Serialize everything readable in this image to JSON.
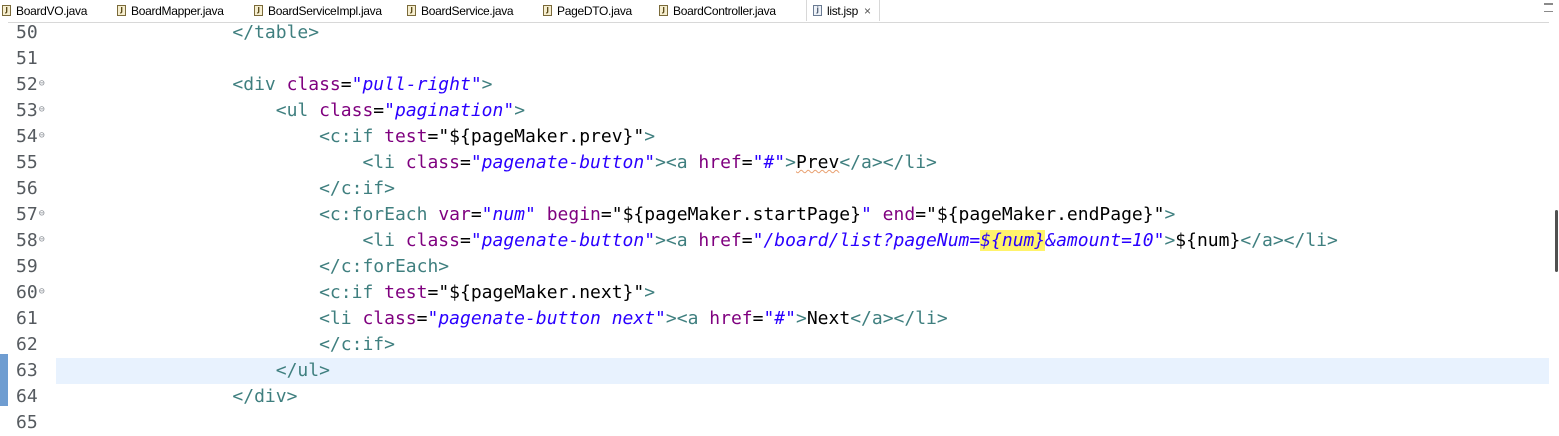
{
  "tabs": [
    {
      "label": "BoardVO.java",
      "icon": "java-file-icon",
      "active": false
    },
    {
      "label": "BoardMapper.java",
      "icon": "java-file-icon",
      "active": false
    },
    {
      "label": "BoardServiceImpl.java",
      "icon": "java-file-icon",
      "active": false
    },
    {
      "label": "BoardService.java",
      "icon": "java-file-icon",
      "active": false
    },
    {
      "label": "PageDTO.java",
      "icon": "java-file-icon",
      "active": false
    },
    {
      "label": "BoardController.java",
      "icon": "java-file-icon",
      "active": false
    },
    {
      "label": "list.jsp",
      "icon": "jsp-file-icon",
      "active": true
    }
  ],
  "tab_close_glyph": "×",
  "colors": {
    "tag": "#3f7f7f",
    "attribute": "#7f007f",
    "string_value": "#2a00ff",
    "current_line": "#e8f2fe",
    "occurrence_highlight": "#fff36b",
    "change_marker": "#6f9dd1"
  },
  "lines": [
    {
      "num": "50",
      "fold": false,
      "indent": "                ",
      "tokens": [
        {
          "t": "tg",
          "v": "</table>"
        }
      ]
    },
    {
      "num": "51",
      "fold": false,
      "indent": "",
      "tokens": []
    },
    {
      "num": "52",
      "fold": true,
      "indent": "                ",
      "tokens": [
        {
          "t": "tg",
          "v": "<div "
        },
        {
          "t": "at",
          "v": "class"
        },
        {
          "t": "tx",
          "v": "="
        },
        {
          "t": "vl",
          "v": "\"pull-right\""
        },
        {
          "t": "tg",
          "v": ">"
        }
      ]
    },
    {
      "num": "53",
      "fold": true,
      "indent": "                    ",
      "tokens": [
        {
          "t": "tg",
          "v": "<ul "
        },
        {
          "t": "at",
          "v": "class"
        },
        {
          "t": "tx",
          "v": "="
        },
        {
          "t": "vl",
          "v": "\"pagination\""
        },
        {
          "t": "tg",
          "v": ">"
        }
      ]
    },
    {
      "num": "54",
      "fold": true,
      "indent": "                        ",
      "tokens": [
        {
          "t": "tg",
          "v": "<c:if "
        },
        {
          "t": "at",
          "v": "test"
        },
        {
          "t": "tx",
          "v": "=\"${pageMaker.prev}\""
        },
        {
          "t": "tg",
          "v": ">"
        }
      ]
    },
    {
      "num": "55",
      "fold": false,
      "indent": "                            ",
      "tokens": [
        {
          "t": "tg",
          "v": "<li "
        },
        {
          "t": "at",
          "v": "class"
        },
        {
          "t": "tx",
          "v": "="
        },
        {
          "t": "vl",
          "v": "\"pagenate-button\""
        },
        {
          "t": "tg",
          "v": "><a "
        },
        {
          "t": "at",
          "v": "href"
        },
        {
          "t": "tx",
          "v": "="
        },
        {
          "t": "vl",
          "v": "\"#\""
        },
        {
          "t": "tg",
          "v": ">"
        },
        {
          "t": "sq",
          "v": "Prev"
        },
        {
          "t": "tg",
          "v": "</a></li>"
        }
      ]
    },
    {
      "num": "56",
      "fold": false,
      "indent": "                        ",
      "tokens": [
        {
          "t": "tg",
          "v": "</c:if>"
        }
      ]
    },
    {
      "num": "57",
      "fold": true,
      "indent": "                        ",
      "tokens": [
        {
          "t": "tg",
          "v": "<c:forEach "
        },
        {
          "t": "at",
          "v": "var"
        },
        {
          "t": "tx",
          "v": "="
        },
        {
          "t": "vl",
          "v": "\"num\""
        },
        {
          "t": "tx",
          "v": " "
        },
        {
          "t": "at",
          "v": "begin"
        },
        {
          "t": "tx",
          "v": "=\"${pageMaker.startPage}"
        },
        {
          "t": "vl",
          "v": "\""
        },
        {
          "t": "tx",
          "v": " "
        },
        {
          "t": "at",
          "v": "end"
        },
        {
          "t": "tx",
          "v": "=\"${pageMaker.endPage}\""
        },
        {
          "t": "tg",
          "v": ">"
        }
      ]
    },
    {
      "num": "58",
      "fold": true,
      "indent": "                            ",
      "tokens": [
        {
          "t": "tg",
          "v": "<li "
        },
        {
          "t": "at",
          "v": "class"
        },
        {
          "t": "tx",
          "v": "="
        },
        {
          "t": "vl",
          "v": "\"pagenate-button\""
        },
        {
          "t": "tg",
          "v": "><a "
        },
        {
          "t": "at",
          "v": "href"
        },
        {
          "t": "tx",
          "v": "="
        },
        {
          "t": "vl",
          "v": "\"/board/list?pageNum="
        },
        {
          "t": "hl",
          "v": "${num}"
        },
        {
          "t": "vl",
          "v": "&amount=10\""
        },
        {
          "t": "tg",
          "v": ">"
        },
        {
          "t": "tx",
          "v": "${num}"
        },
        {
          "t": "tg",
          "v": "</a></li>"
        }
      ]
    },
    {
      "num": "59",
      "fold": false,
      "indent": "                        ",
      "tokens": [
        {
          "t": "tg",
          "v": "</c:forEach>"
        }
      ]
    },
    {
      "num": "60",
      "fold": true,
      "indent": "                        ",
      "tokens": [
        {
          "t": "tg",
          "v": "<c:if "
        },
        {
          "t": "at",
          "v": "test"
        },
        {
          "t": "tx",
          "v": "=\"${pageMaker.next}\""
        },
        {
          "t": "tg",
          "v": ">"
        }
      ]
    },
    {
      "num": "61",
      "fold": false,
      "indent": "                        ",
      "tokens": [
        {
          "t": "tg",
          "v": "<li "
        },
        {
          "t": "at",
          "v": "class"
        },
        {
          "t": "tx",
          "v": "="
        },
        {
          "t": "vl",
          "v": "\"pagenate-button next\""
        },
        {
          "t": "tg",
          "v": "><a "
        },
        {
          "t": "at",
          "v": "href"
        },
        {
          "t": "tx",
          "v": "="
        },
        {
          "t": "vl",
          "v": "\"#\""
        },
        {
          "t": "tg",
          "v": ">"
        },
        {
          "t": "tx",
          "v": "Next"
        },
        {
          "t": "tg",
          "v": "</a></li>"
        }
      ]
    },
    {
      "num": "62",
      "fold": false,
      "indent": "                        ",
      "tokens": [
        {
          "t": "tg",
          "v": "</c:if>"
        }
      ]
    },
    {
      "num": "63",
      "fold": false,
      "current": true,
      "indent": "                    ",
      "tokens": [
        {
          "t": "tg",
          "v": "</ul>"
        }
      ]
    },
    {
      "num": "64",
      "fold": false,
      "indent": "                ",
      "tokens": [
        {
          "t": "tg",
          "v": "</div>"
        }
      ]
    },
    {
      "num": "65",
      "fold": false,
      "indent": "",
      "tokens": []
    }
  ]
}
